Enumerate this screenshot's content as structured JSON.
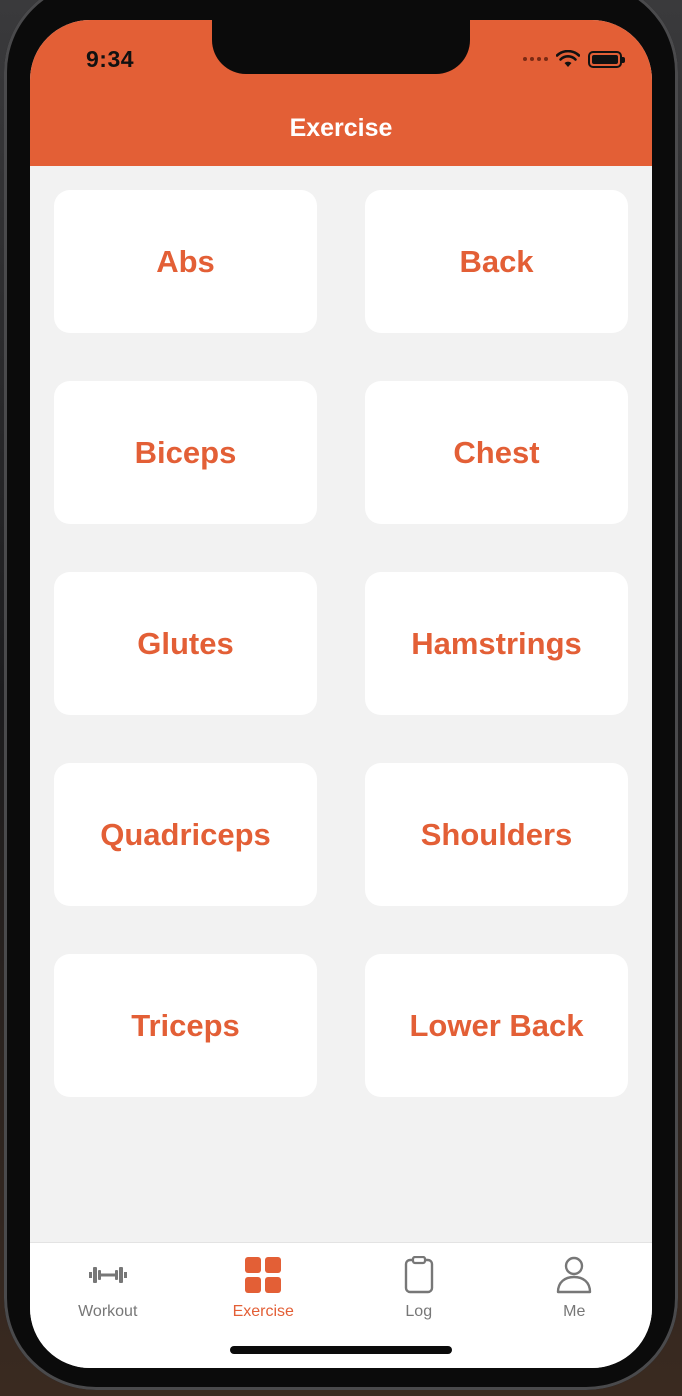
{
  "status": {
    "time": "9:34"
  },
  "header": {
    "title": "Exercise"
  },
  "categories": [
    "Abs",
    "Back",
    "Biceps",
    "Chest",
    "Glutes",
    "Hamstrings",
    "Quadriceps",
    "Shoulders",
    "Triceps",
    "Lower Back"
  ],
  "tabs": [
    {
      "label": "Workout",
      "icon": "dumbbell-icon",
      "active": false
    },
    {
      "label": "Exercise",
      "icon": "grid-icon",
      "active": true
    },
    {
      "label": "Log",
      "icon": "clipboard-icon",
      "active": false
    },
    {
      "label": "Me",
      "icon": "person-icon",
      "active": false
    }
  ],
  "colors": {
    "accent": "#e35f36",
    "background": "#f2f2f2",
    "card": "#ffffff",
    "inactive_tab": "#777777"
  }
}
